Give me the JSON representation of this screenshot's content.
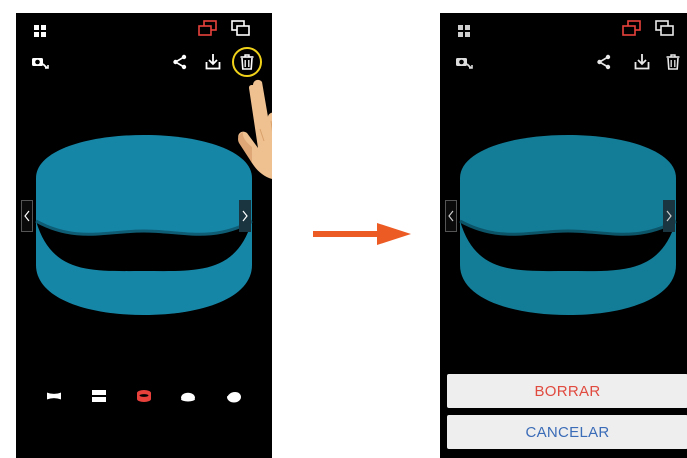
{
  "colors": {
    "ring": "#1686a7",
    "ring_dimmed": "#137d98",
    "accent_red": "#e8413c",
    "highlight": "#f1d21a",
    "arrow": "#ec5b24",
    "delete_text": "#e04a3f",
    "cancel_text": "#3b6cb7",
    "icon_white": "#ffffff"
  },
  "left_phone": {
    "toolbar_icons": [
      "grid-icon",
      "multi-view-red-icon",
      "multi-view-icon",
      "camera-rotate-icon",
      "share-icon",
      "download-icon",
      "trash-icon"
    ],
    "mode_icons": [
      "panorama-icon",
      "dual-view-icon",
      "cylinder-view-icon",
      "dome-view-icon",
      "fisheye-view-icon"
    ],
    "selected_mode": "cylinder-view-icon"
  },
  "right_phone": {
    "dialog": {
      "delete_label": "BORRAR",
      "cancel_label": "CANCELAR"
    }
  }
}
